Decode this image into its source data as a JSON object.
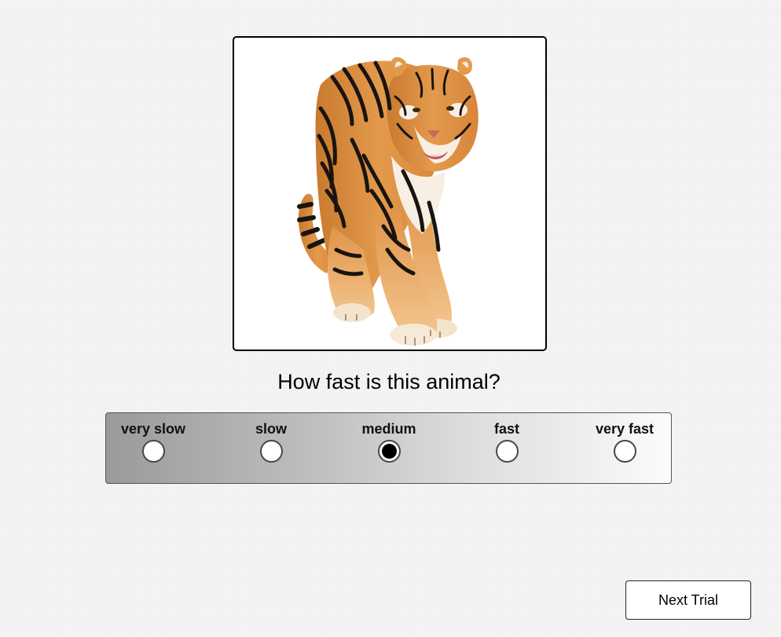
{
  "stimulus": {
    "subject": "tiger"
  },
  "question": "How fast is this animal?",
  "scale": {
    "options": [
      {
        "label": "very slow",
        "selected": false
      },
      {
        "label": "slow",
        "selected": false
      },
      {
        "label": "medium",
        "selected": true
      },
      {
        "label": "fast",
        "selected": false
      },
      {
        "label": "very fast",
        "selected": false
      }
    ]
  },
  "next_button": {
    "label": "Next Trial"
  },
  "colors": {
    "background": "#f2f2f2",
    "scale_left": "#9a9a9a",
    "scale_right": "#fbfbfb",
    "radio_border": "#3e4a54",
    "tiger_orange": "#d98a3a",
    "tiger_stripe": "#1a1410"
  }
}
